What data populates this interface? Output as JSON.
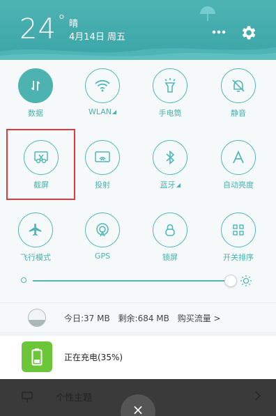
{
  "header": {
    "temperature": "24",
    "degree_symbol": "°",
    "weather": "晴",
    "date": "4月14日 周五"
  },
  "toggles": [
    {
      "label": "数据",
      "icon": "data-transfer-icon",
      "active": true
    },
    {
      "label": "WLAN",
      "icon": "wifi-icon",
      "active": false,
      "expandable": true
    },
    {
      "label": "手电筒",
      "icon": "flashlight-icon",
      "active": false
    },
    {
      "label": "静音",
      "icon": "mute-bell-icon",
      "active": false
    },
    {
      "label": "截屏",
      "icon": "screenshot-scissors-icon",
      "active": false
    },
    {
      "label": "投射",
      "icon": "cast-icon",
      "active": false
    },
    {
      "label": "蓝牙",
      "icon": "bluetooth-icon",
      "active": false,
      "expandable": true
    },
    {
      "label": "自动亮度",
      "icon": "auto-brightness-icon",
      "active": false
    },
    {
      "label": "飞行模式",
      "icon": "airplane-icon",
      "active": false
    },
    {
      "label": "GPS",
      "icon": "gps-icon",
      "active": false
    },
    {
      "label": "锁屏",
      "icon": "lock-icon",
      "active": false
    },
    {
      "label": "开关排序",
      "icon": "grid-sort-icon",
      "active": false
    }
  ],
  "brightness": {
    "level": 1.0
  },
  "data_usage": {
    "today": "今日:37 MB",
    "remaining": "剩余:684 MB",
    "buy": "购买流量 >"
  },
  "charging": {
    "text": "正在充电(35%)",
    "percent": 35
  },
  "bottom": {
    "theme_label": "个性主题",
    "close_symbol": "×"
  },
  "colors": {
    "accent": "#4fb7b5",
    "header": "#3aa5a7",
    "battery": "#6cc63a",
    "highlight": "#e23a3a"
  }
}
